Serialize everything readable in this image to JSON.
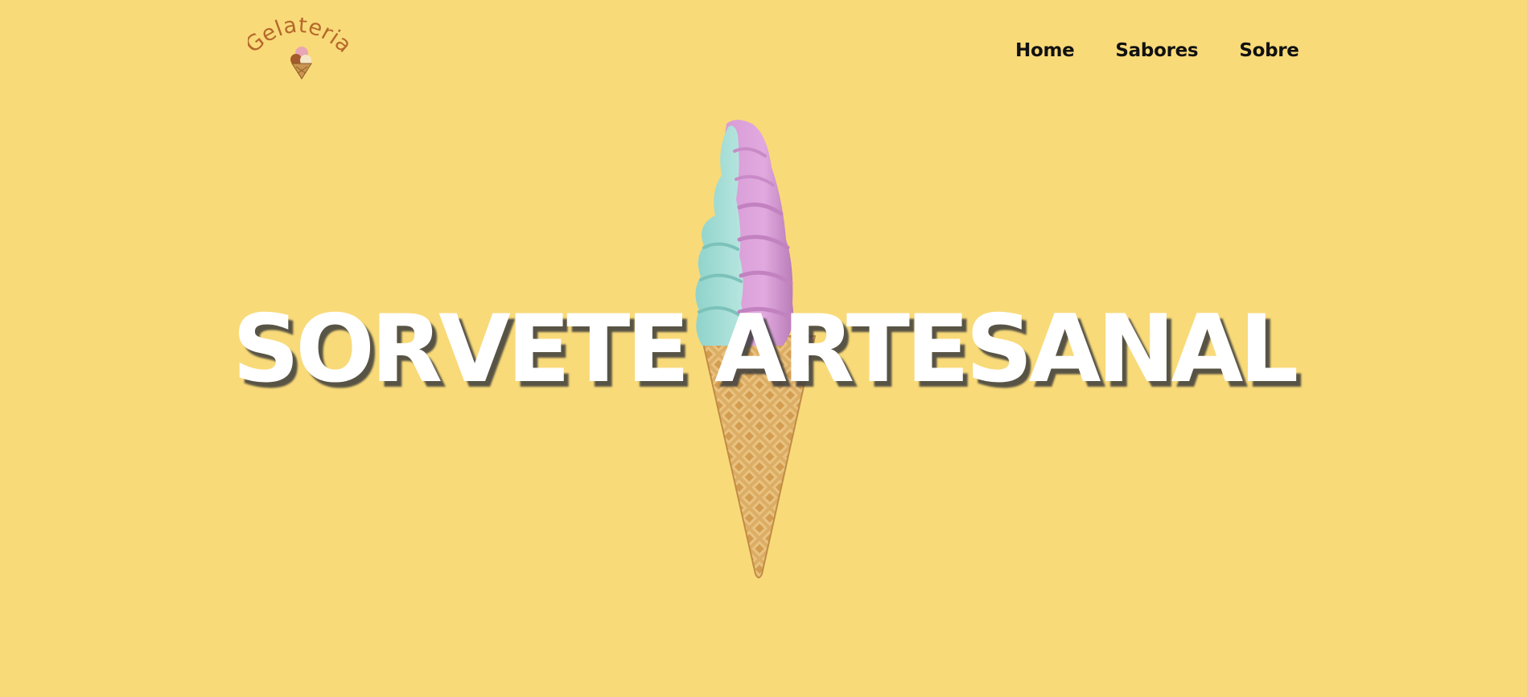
{
  "brand": {
    "logo_text": "Gelateria",
    "logo_color": "#b5692b",
    "icon": "ice-cream-logo-icon"
  },
  "nav": {
    "items": [
      {
        "label": "Home"
      },
      {
        "label": "Sabores"
      },
      {
        "label": "Sobre"
      }
    ]
  },
  "hero": {
    "title": "SORVETE ARTESANAL",
    "image": "soft-serve-ice-cream-cone",
    "background_color": "#f9da79"
  }
}
